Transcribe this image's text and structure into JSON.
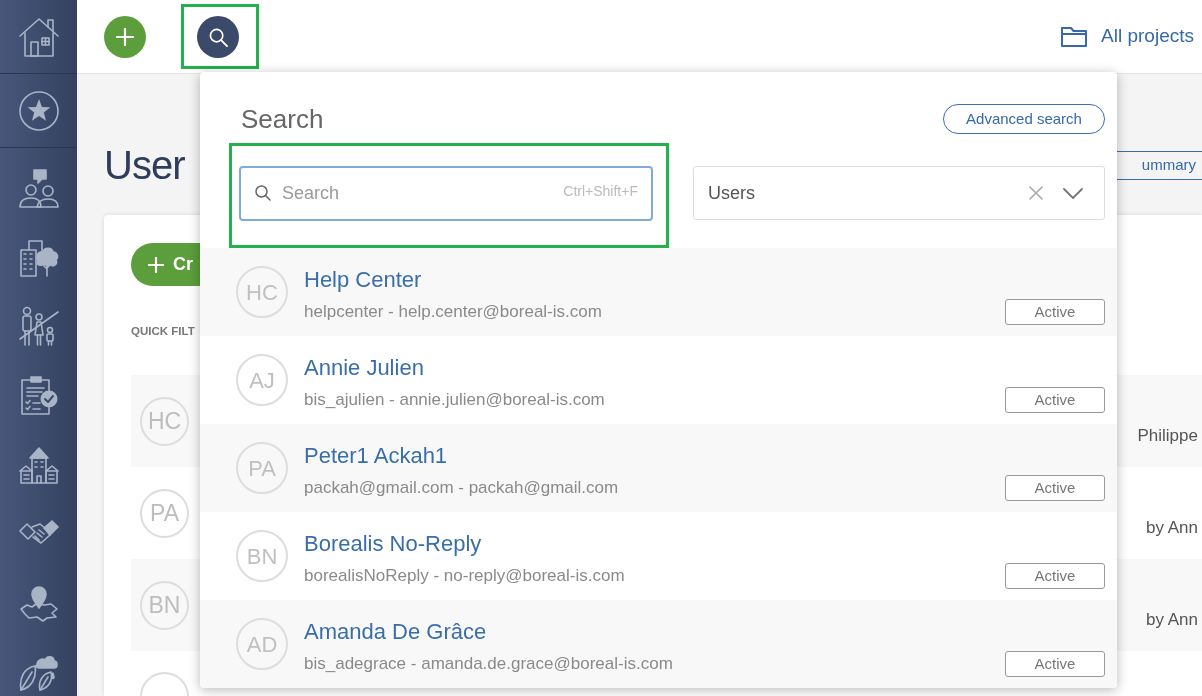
{
  "sidebar": {
    "items": [
      {
        "kind": "home"
      },
      {
        "kind": "favorites"
      },
      {
        "kind": "people"
      },
      {
        "kind": "building"
      },
      {
        "kind": "family"
      },
      {
        "kind": "checklist"
      },
      {
        "kind": "housing"
      },
      {
        "kind": "handshake"
      },
      {
        "kind": "map"
      },
      {
        "kind": "nature"
      }
    ]
  },
  "top_bar": {
    "search_button": {
      "highlighted": true
    },
    "projects_link": "All projects"
  },
  "page": {
    "title": "User",
    "summary_button": "ummary",
    "create_button": "Cr",
    "quick_filters_label": "QUICK FILT",
    "rows": [
      {
        "kind": "row",
        "initials": "HC",
        "trailing": "Philippe"
      },
      {
        "kind": "row",
        "initials": "PA",
        "trailing": "by Ann"
      },
      {
        "kind": "row",
        "initials": "BN",
        "trailing": "by Ann"
      },
      {
        "kind": "cut_off"
      }
    ]
  },
  "search_popup": {
    "title": "Search",
    "advanced_search_button": "Advanced search",
    "search_field": {
      "placeholder": "Search",
      "shortcut": "Ctrl+Shift+F",
      "highlighted": true
    },
    "scope_select": {
      "value": "Users"
    },
    "results": [
      {
        "initials": "HC",
        "name": "Help Center",
        "detail": "helpcenter - help.center@boreal-is.com",
        "status": "Active"
      },
      {
        "initials": "AJ",
        "name": "Annie Julien",
        "detail": "bis_ajulien - annie.julien@boreal-is.com",
        "status": "Active"
      },
      {
        "initials": "PA",
        "name": "Peter1 Ackah1",
        "detail": "packah@gmail.com - packah@gmail.com",
        "status": "Active"
      },
      {
        "initials": "BN",
        "name": "Borealis No-Reply",
        "detail": "borealisNoReply - no-reply@boreal-is.com",
        "status": "Active"
      },
      {
        "initials": "AD",
        "name": "Amanda De Grâce",
        "detail": "bis_adegrace - amanda.de.grace@boreal-is.com",
        "status": "Active"
      }
    ]
  }
}
